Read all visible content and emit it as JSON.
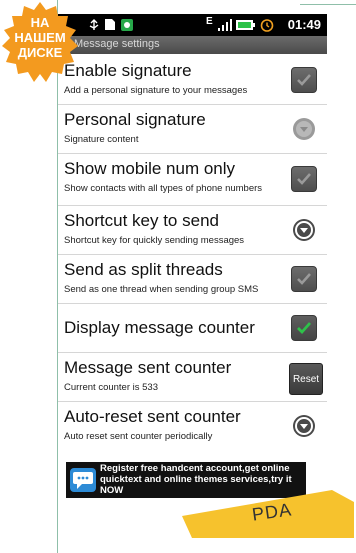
{
  "badge": {
    "line1": "НА",
    "line2": "НАШЕМ",
    "line3": "ДИСКЕ"
  },
  "statusbar": {
    "time": "01:49",
    "signal_label": "E"
  },
  "titlebar": {
    "text": "Message settings"
  },
  "settings": [
    {
      "title": "Enable signature",
      "subtitle": "Add a personal signature to your messages",
      "control": "checkbox",
      "checked": true
    },
    {
      "title": "Personal signature",
      "subtitle": "Signature content",
      "control": "radio-light"
    },
    {
      "title": "Show mobile num only",
      "subtitle": "Show contacts with all types of phone numbers",
      "control": "checkbox",
      "checked": true
    },
    {
      "title": "Shortcut key to send",
      "subtitle": "Shortcut key for quickly sending messages",
      "control": "radio"
    },
    {
      "title": "Send as split threads",
      "subtitle": "Send as one thread when sending group SMS",
      "control": "checkbox",
      "checked": true
    },
    {
      "title": "Display message counter",
      "subtitle": "",
      "control": "checkbox-green",
      "checked": true
    },
    {
      "title": "Message sent counter",
      "subtitle": "Current counter is 533",
      "control": "button",
      "button_label": "Reset"
    },
    {
      "title": "Auto-reset sent counter",
      "subtitle": "Auto reset sent counter periodically",
      "control": "radio"
    }
  ],
  "banner": {
    "text": "Register free handcent account,get online quicktext and online themes services,try it NOW"
  },
  "footer_tag": {
    "text": "PDA"
  },
  "colors": {
    "badge_orange": "#f39a1f",
    "green_check": "#2ec24a",
    "tag_yellow": "#f6c22d"
  }
}
